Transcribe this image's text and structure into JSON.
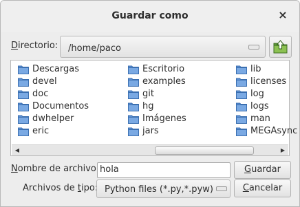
{
  "window": {
    "title": "Guardar como",
    "close_glyph": "×"
  },
  "directory": {
    "label_prefix": "D",
    "label_rest": "irectorio:",
    "current": "/home/paco",
    "up_button_icon": "folder-up-icon"
  },
  "files": {
    "columns": [
      [
        "Descargas",
        "devel",
        "doc",
        "Documentos",
        "dwhelper",
        "eric"
      ],
      [
        "Escritorio",
        "examples",
        "git",
        "hg",
        "Imágenes",
        "jars"
      ],
      [
        "lib",
        "licenses",
        "log",
        "logs",
        "man",
        "MEGAsync"
      ]
    ],
    "folder_color": "#5b8fd3"
  },
  "filename": {
    "label_prefix": "N",
    "label_rest": "ombre de archivo:",
    "value": "hola"
  },
  "filetype": {
    "label_start": "Archivos de ",
    "label_key": "t",
    "label_end": "ipo:",
    "selected": "Python files (*.py,*.pyw)"
  },
  "buttons": {
    "save_key": "G",
    "save_rest": "uardar",
    "cancel_key": "C",
    "cancel_rest": "ancelar"
  }
}
